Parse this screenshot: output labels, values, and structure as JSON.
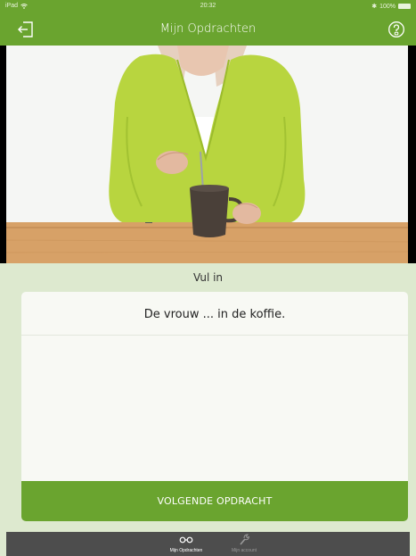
{
  "status_bar": {
    "device": "iPad",
    "time": "20:32",
    "battery": "100%"
  },
  "nav": {
    "title": "Mijn Opdrachten",
    "left_icon": "exit-icon",
    "right_icon": "help-icon"
  },
  "exercise": {
    "instruction": "Vul in",
    "sentence": "De vrouw ... in de koffie.",
    "answer_value": "",
    "next_button_label": "VOLGENDE OPDRACHT"
  },
  "tab_bar": {
    "tabs": [
      {
        "label": "Mijn Opdrachten",
        "icon": "glasses-icon",
        "active": true
      },
      {
        "label": "Mijn account",
        "icon": "wrench-icon",
        "active": false
      }
    ]
  },
  "colors": {
    "brand_green": "#6aa42f",
    "background": "#dde9cf",
    "tab_bar": "#4d4d4d"
  }
}
